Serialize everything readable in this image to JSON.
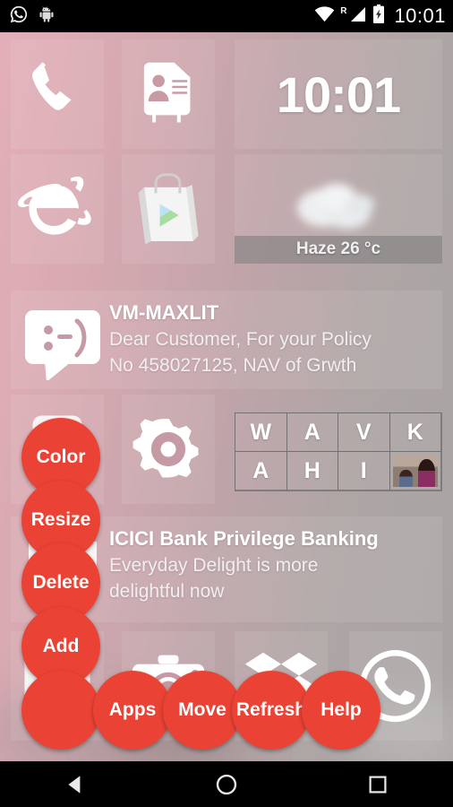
{
  "status_bar": {
    "clock": "10:01",
    "left_icons": [
      {
        "name": "whatsapp-notification-icon",
        "label": "WhatsApp"
      },
      {
        "name": "android-system-icon",
        "label": "Android"
      }
    ],
    "right_icons": [
      {
        "name": "wifi-icon",
        "label": "Wi-Fi"
      },
      {
        "name": "roaming-indicator",
        "label": "R"
      },
      {
        "name": "cellular-signal-icon",
        "label": "Signal"
      },
      {
        "name": "battery-charging-icon",
        "label": "Battery charging"
      }
    ]
  },
  "home": {
    "clock_widget": {
      "time": "10:01"
    },
    "weather_widget": {
      "condition": "Haze",
      "temperature": "26 °c",
      "label": "Haze 26 °c"
    },
    "tiles": [
      {
        "name": "phone",
        "icon": "phone-icon",
        "label": "Phone"
      },
      {
        "name": "contacts",
        "icon": "contacts-card-icon",
        "label": "Contacts"
      },
      {
        "name": "browser",
        "icon": "internet-explorer-icon",
        "label": "Internet"
      },
      {
        "name": "play-store",
        "icon": "play-store-bag-icon",
        "label": "Play Store"
      },
      {
        "name": "calculator",
        "icon": "calculator-icon",
        "label": "Calculator"
      },
      {
        "name": "settings",
        "icon": "gear-icon",
        "label": "Settings"
      },
      {
        "name": "gallery",
        "icon": "gallery-photos-icon",
        "label": "Gallery"
      },
      {
        "name": "camera",
        "icon": "camera-icon",
        "label": "Camera"
      },
      {
        "name": "dropbox",
        "icon": "dropbox-icon",
        "label": "Dropbox"
      },
      {
        "name": "whatsapp",
        "icon": "whatsapp-icon",
        "label": "WhatsApp"
      }
    ],
    "sms_widget": {
      "sender": "VM-MAXLIT",
      "line1": "Dear Customer, For your Policy",
      "line2": "No 458027125, NAV of Grwth",
      "icon": "sms-smiley-bubble-icon"
    },
    "email_widget": {
      "subject": "ICICI Bank Privilege Banking",
      "line1": "Everyday Delight is more",
      "line2": "delightful now",
      "icon": "envelope-icon"
    },
    "contacts_grid": {
      "cells": [
        {
          "type": "letter",
          "value": "W"
        },
        {
          "type": "letter",
          "value": "A"
        },
        {
          "type": "letter",
          "value": "V"
        },
        {
          "type": "letter",
          "value": "K"
        },
        {
          "type": "letter",
          "value": "A"
        },
        {
          "type": "letter",
          "value": "H"
        },
        {
          "type": "letter",
          "value": "I"
        },
        {
          "type": "photo",
          "value": ""
        }
      ]
    }
  },
  "action_menu": {
    "accent_color": "#ea4335",
    "buttons": [
      {
        "id": "color",
        "label": "Color"
      },
      {
        "id": "resize",
        "label": "Resize"
      },
      {
        "id": "delete",
        "label": "Delete"
      },
      {
        "id": "add",
        "label": "Add"
      },
      {
        "id": "blank",
        "label": ""
      },
      {
        "id": "apps",
        "label": "Apps"
      },
      {
        "id": "move",
        "label": "Move"
      },
      {
        "id": "refresh",
        "label": "Refresh"
      },
      {
        "id": "help",
        "label": "Help"
      }
    ]
  },
  "nav_bar": {
    "back": "Back",
    "home": "Home",
    "recents": "Recent apps"
  }
}
